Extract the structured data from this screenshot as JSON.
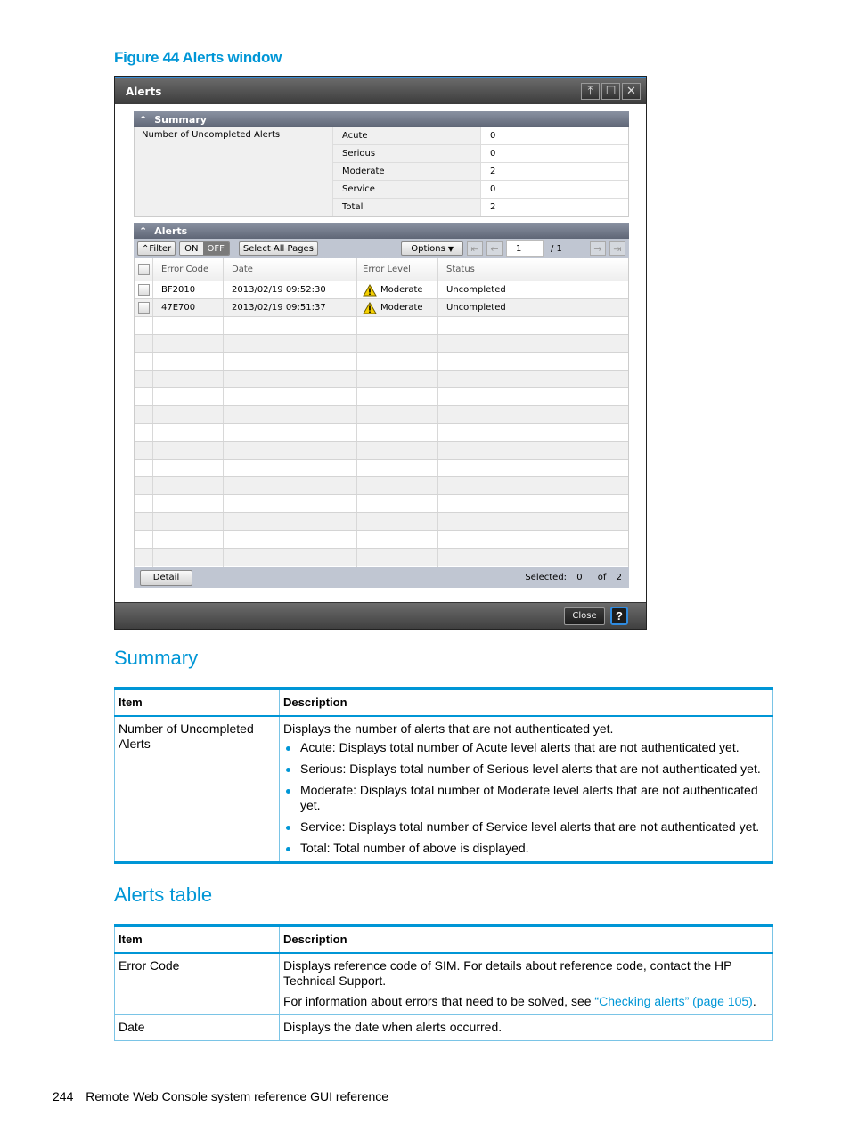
{
  "figure_caption": "Figure 44 Alerts window",
  "window": {
    "title": "Alerts",
    "controls": [
      "pin-icon",
      "maximize-icon",
      "close-icon"
    ],
    "summary": {
      "heading": "Summary",
      "label": "Number of Uncompleted Alerts",
      "rows": [
        {
          "key": "Acute",
          "value": "0"
        },
        {
          "key": "Serious",
          "value": "0"
        },
        {
          "key": "Moderate",
          "value": "2"
        },
        {
          "key": "Service",
          "value": "0"
        },
        {
          "key": "Total",
          "value": "2"
        }
      ]
    },
    "alerts": {
      "heading": "Alerts",
      "toolbar": {
        "filter_label": "Filter",
        "on_label": "ON",
        "off_label": "OFF",
        "select_all_label": "Select All Pages",
        "options_label": "Options",
        "page_value": "1",
        "page_total": "/ 1"
      },
      "columns": [
        "Error Code",
        "Date",
        "Error Level",
        "Status",
        ""
      ],
      "rows": [
        {
          "code": "BF2010",
          "date": "2013/02/19 09:52:30",
          "level": "Moderate",
          "status": "Uncompleted"
        },
        {
          "code": "47E700",
          "date": "2013/02/19 09:51:37",
          "level": "Moderate",
          "status": "Uncompleted"
        }
      ],
      "detail_label": "Detail",
      "selected_label": "Selected:",
      "selected_count": "0",
      "of_label": "of",
      "total_count": "2"
    },
    "close_label": "Close",
    "help_label": "?"
  },
  "sections": {
    "summary": {
      "title": "Summary",
      "header_item": "Item",
      "header_desc": "Description",
      "rows": [
        {
          "item": "Number of Uncompleted Alerts",
          "desc": "Displays the number of alerts that are not authenticated yet.",
          "bullets": [
            "Acute: Displays total number of Acute level alerts that are not authenticated yet.",
            "Serious: Displays total number of Serious level alerts that are not authenticated yet.",
            "Moderate: Displays total number of Moderate level alerts that are not authenticated yet.",
            "Service: Displays total number of Service level alerts that are not authenticated yet.",
            "Total: Total number of above is displayed."
          ]
        }
      ]
    },
    "alerts_table": {
      "title": "Alerts table",
      "header_item": "Item",
      "header_desc": "Description",
      "rows": [
        {
          "item": "Error Code",
          "desc": "Displays reference code of SIM. For details about reference code, contact the HP Technical Support.",
          "desc2_prefix": "For information about errors that need to be solved, see ",
          "desc2_link": "“Checking alerts” (page 105)",
          "desc2_suffix": "."
        },
        {
          "item": "Date",
          "desc": "Displays the date when alerts occurred."
        }
      ]
    }
  },
  "footer": {
    "page_number": "244",
    "text": "Remote Web Console system reference GUI reference"
  },
  "colors": {
    "accent": "#0096d6"
  }
}
